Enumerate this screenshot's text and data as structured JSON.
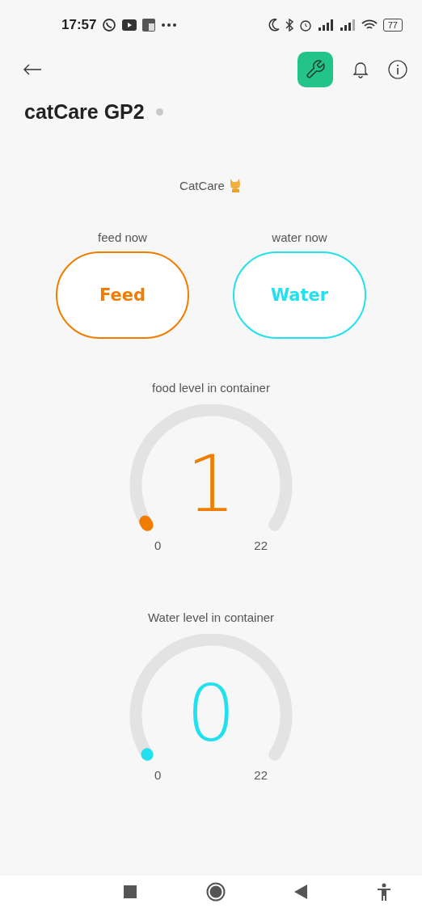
{
  "status_bar": {
    "time": "17:57",
    "battery": "77"
  },
  "header": {
    "settings_selected": true
  },
  "device": {
    "name": "catCare GP2",
    "online": false
  },
  "dashboard": {
    "title": "CatCare",
    "buttons": [
      {
        "caption": "feed now",
        "label": "Feed",
        "color": "#f07d00"
      },
      {
        "caption": "water now",
        "label": "Water",
        "color": "#22e0ee"
      }
    ],
    "gauges": [
      {
        "title": "food level in container",
        "value": "1",
        "min": "0",
        "max": "22",
        "color": "#f07d00"
      },
      {
        "title": "Water level in container",
        "value": "0",
        "min": "0",
        "max": "22",
        "color": "#22e0ee"
      }
    ]
  }
}
